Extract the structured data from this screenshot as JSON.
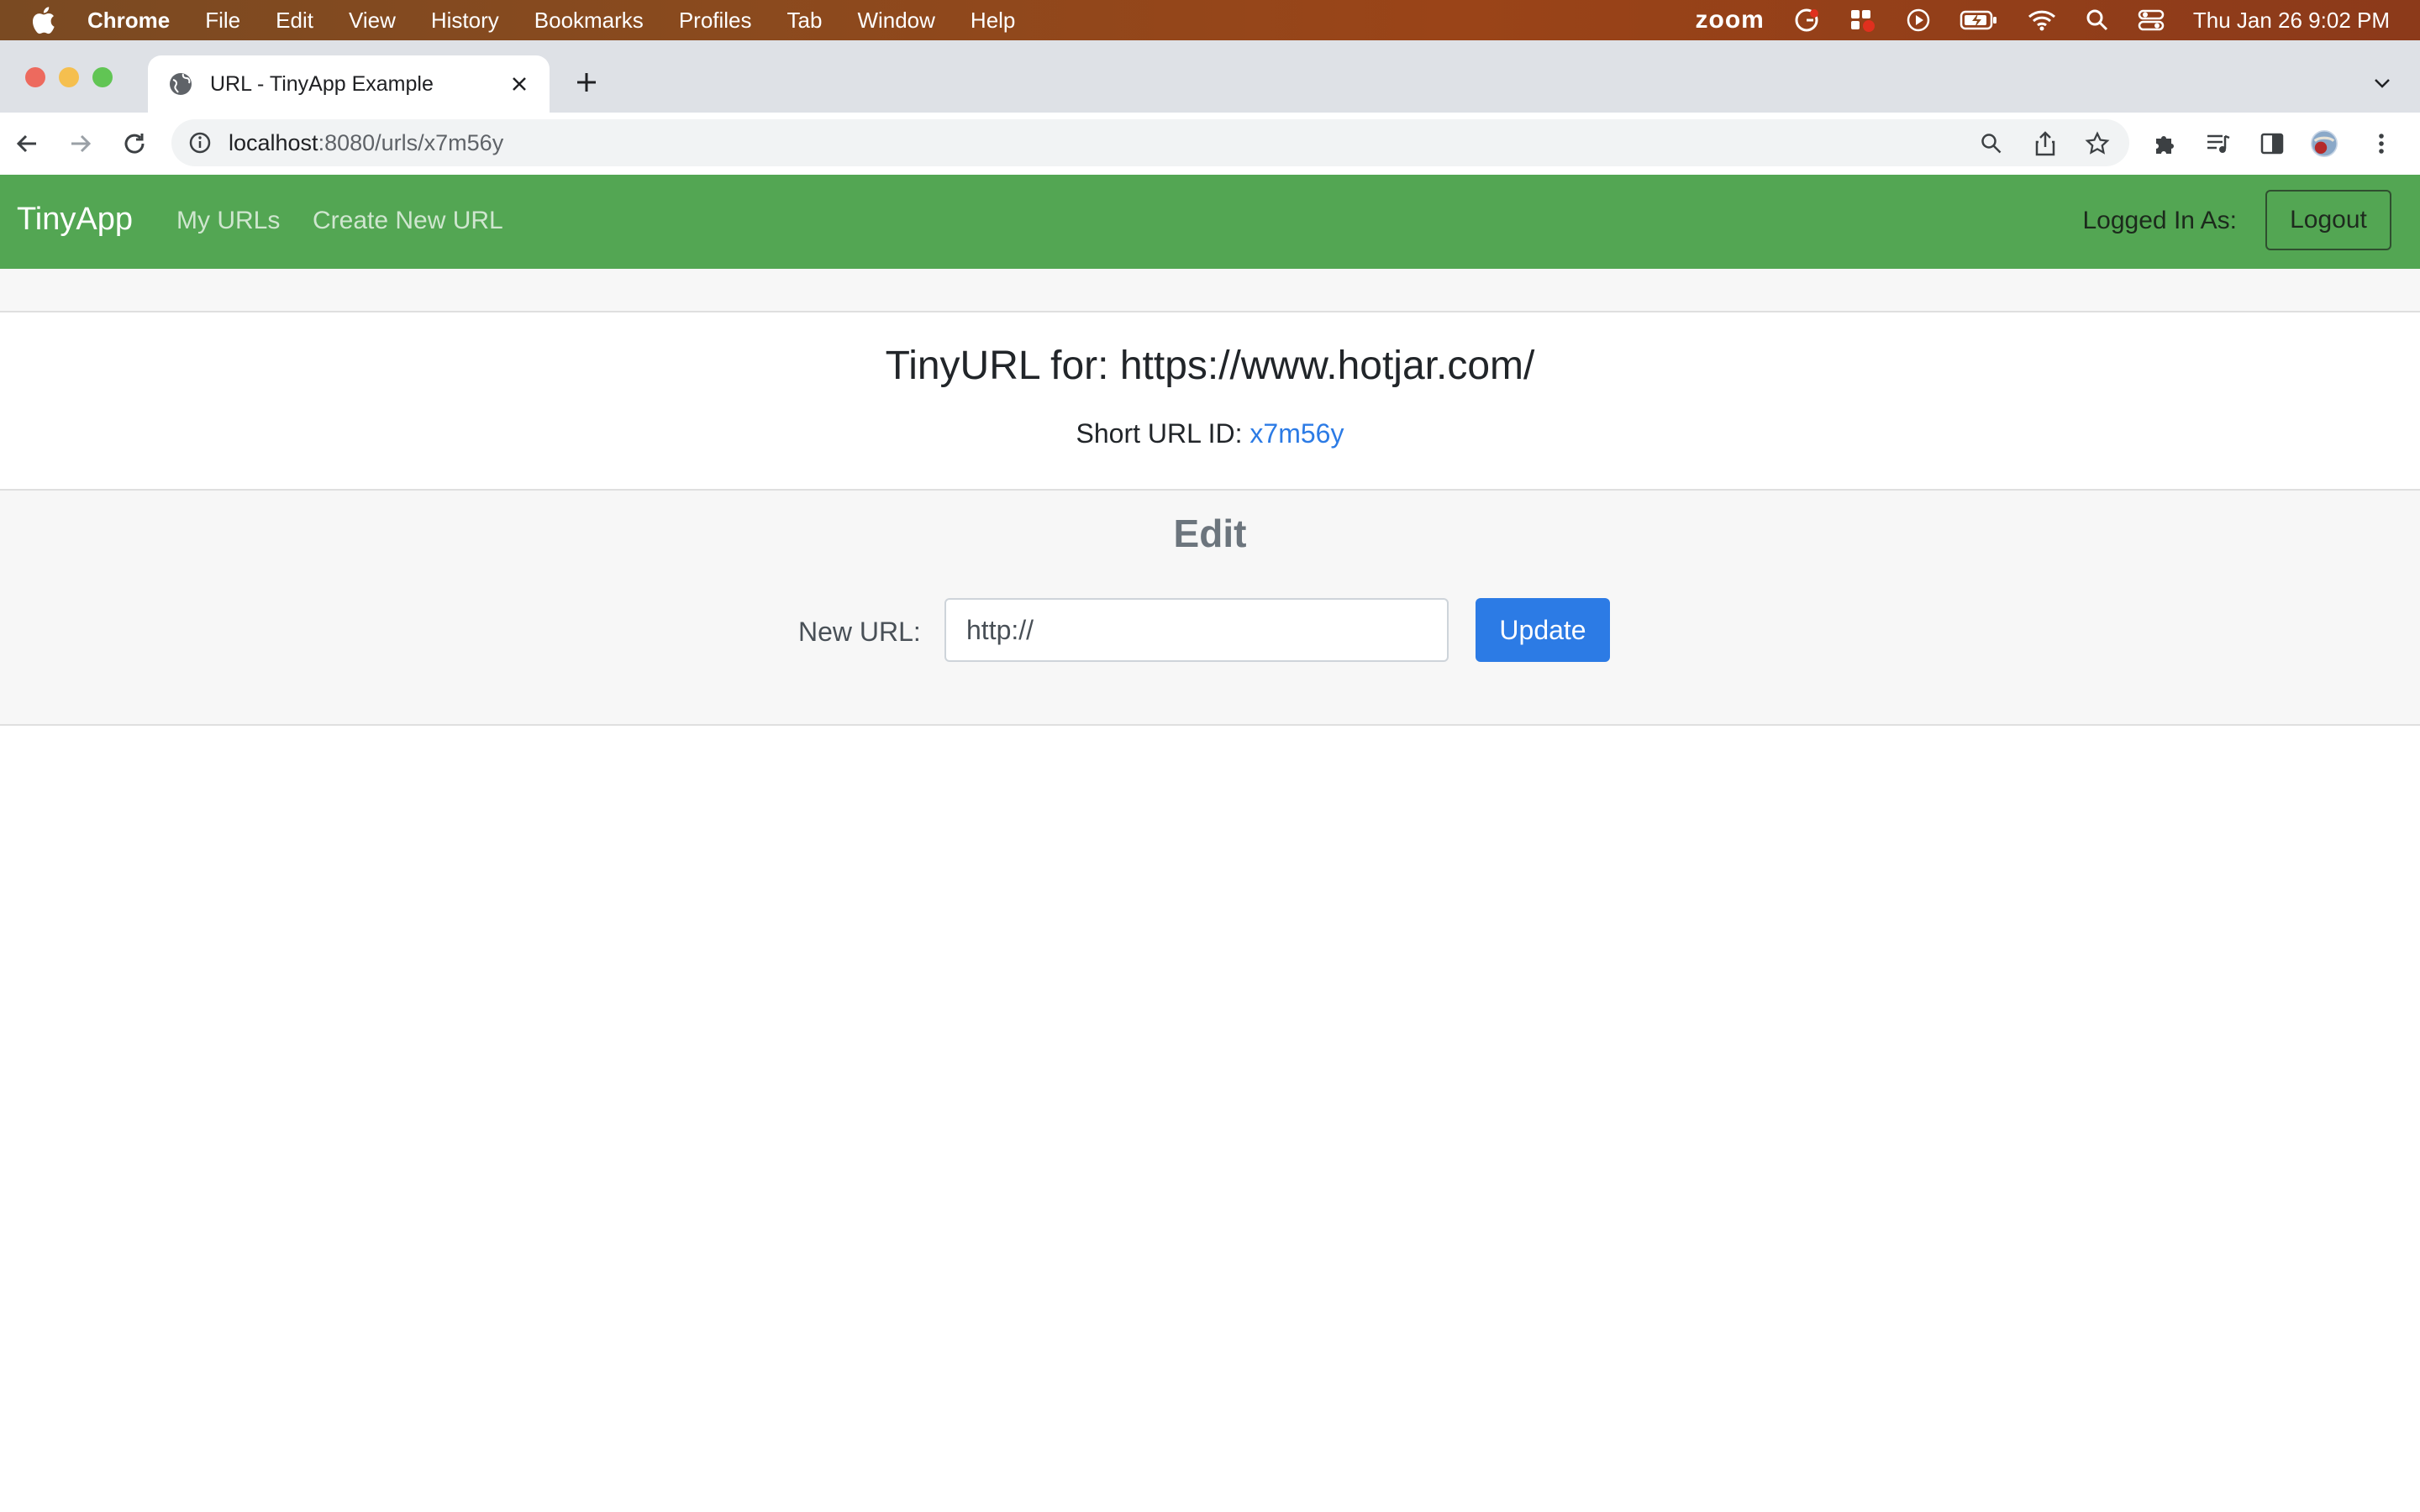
{
  "menubar": {
    "app": "Chrome",
    "items": [
      "File",
      "Edit",
      "View",
      "History",
      "Bookmarks",
      "Profiles",
      "Tab",
      "Window",
      "Help"
    ],
    "zoom": "zoom",
    "clock": "Thu Jan 26  9:02 PM"
  },
  "browser": {
    "tab_title": "URL - TinyApp Example",
    "url_host": "localhost",
    "url_path": ":8080/urls/x7m56y"
  },
  "nav": {
    "brand": "TinyApp",
    "links": [
      "My URLs",
      "Create New URL"
    ],
    "logged_in_label": "Logged In As:",
    "logout_label": "Logout"
  },
  "main": {
    "title": "TinyURL for: https://www.hotjar.com/",
    "short_label": "Short URL ID:",
    "short_id": "x7m56y"
  },
  "edit": {
    "heading": "Edit",
    "label": "New URL:",
    "placeholder": "http://",
    "button": "Update"
  },
  "colors": {
    "navbar": "#53a653",
    "primary": "#2c7be5",
    "link": "#2c7be5"
  }
}
